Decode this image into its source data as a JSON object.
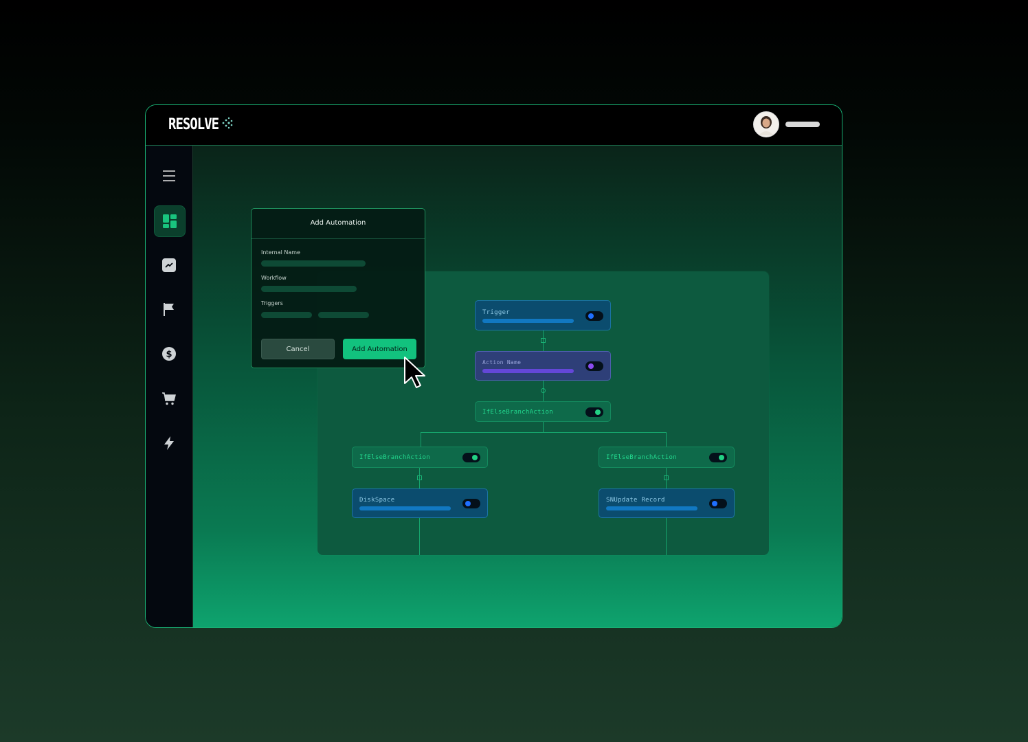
{
  "app": {
    "brand": "RESOLVE"
  },
  "colors": {
    "accent": "#12c27e",
    "border": "#19b174",
    "node_blue": "#0a4c72",
    "node_purple": "#2f3d7a",
    "node_green": "#0e6a4a"
  },
  "sidebar": {
    "items": [
      {
        "icon": "menu-icon"
      },
      {
        "icon": "dashboard-icon",
        "active": true
      },
      {
        "icon": "chart-icon"
      },
      {
        "icon": "flag-icon"
      },
      {
        "icon": "dollar-icon"
      },
      {
        "icon": "cart-icon"
      },
      {
        "icon": "lightning-icon"
      }
    ]
  },
  "dialog": {
    "title": "Add Automation",
    "fields": [
      "Internal Name",
      "Workflow",
      "Triggers"
    ],
    "cancel_label": "Cancel",
    "submit_label": "Add Automation"
  },
  "workflow": {
    "nodes": [
      {
        "id": "trigger",
        "title": "Trigger",
        "toggle": "blue"
      },
      {
        "id": "action",
        "title": "Action Name",
        "toggle": "purple"
      },
      {
        "id": "ifelse-root",
        "title": "IfElseBranchAction",
        "toggle": "green"
      },
      {
        "id": "ifelse-left",
        "title": "IfElseBranchAction",
        "toggle": "green"
      },
      {
        "id": "ifelse-right",
        "title": "IfElseBranchAction",
        "toggle": "green"
      },
      {
        "id": "diskspace",
        "title": "DiskSpace",
        "toggle": "blue"
      },
      {
        "id": "snupdate",
        "title": "SNUpdate Record",
        "toggle": "blue"
      }
    ]
  }
}
